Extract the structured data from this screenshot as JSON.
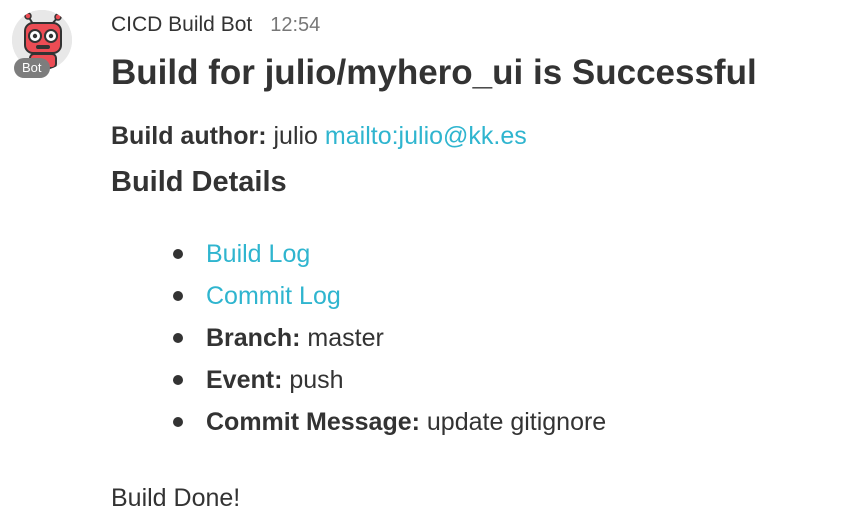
{
  "message": {
    "sender": "CICD Build Bot",
    "time": "12:54",
    "bot_badge": "Bot",
    "avatar_icon": "robot-icon",
    "title": "Build for julio/myhero_ui is Successful",
    "author": {
      "label": "Build author:",
      "name": "julio",
      "email_link": "mailto:julio@kk.es"
    },
    "details_heading": "Build Details",
    "details": [
      {
        "link": "Build Log"
      },
      {
        "link": "Commit Log"
      },
      {
        "label": "Branch:",
        "value": "master"
      },
      {
        "label": "Event:",
        "value": "push"
      },
      {
        "label": "Commit Message:",
        "value": "update gitignore"
      }
    ],
    "footer": "Build Done!"
  },
  "colors": {
    "link": "#2fb5cf",
    "text": "#333333",
    "timestamp": "#777777",
    "avatar_red": "#ec4c54",
    "badge": "#7d7d7d"
  }
}
